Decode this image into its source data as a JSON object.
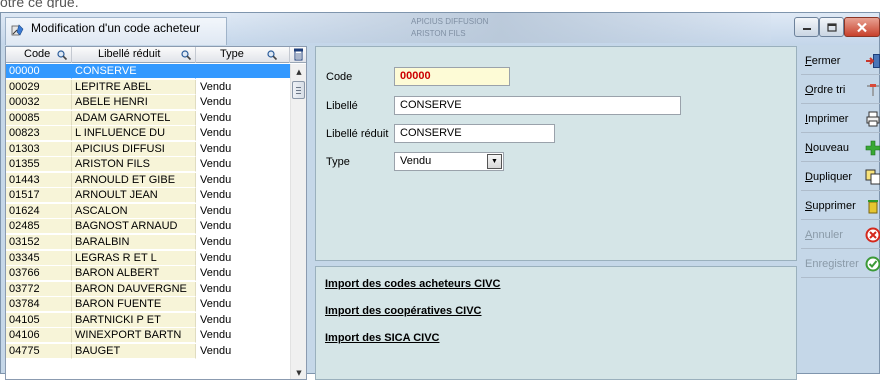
{
  "top_cut_text": "otre ce grue.",
  "window": {
    "title": "Modification d'un code acheteur",
    "background_blur_text": [
      "APICIUS DIFFUSION",
      "ARISTON FILS"
    ]
  },
  "grid": {
    "headers": [
      "Code",
      "Libellé réduit",
      "Type"
    ],
    "selected_index": 0,
    "rows": [
      {
        "code": "00000",
        "libelle": "CONSERVE",
        "type": ""
      },
      {
        "code": "00029",
        "libelle": "LEPITRE ABEL",
        "type": "Vendu"
      },
      {
        "code": "00032",
        "libelle": "ABELE HENRI",
        "type": "Vendu"
      },
      {
        "code": "00085",
        "libelle": "ADAM GARNOTEL",
        "type": "Vendu"
      },
      {
        "code": "00823",
        "libelle": "L INFLUENCE DU",
        "type": "Vendu"
      },
      {
        "code": "01303",
        "libelle": "APICIUS DIFFUSI",
        "type": "Vendu"
      },
      {
        "code": "01355",
        "libelle": "ARISTON FILS",
        "type": "Vendu"
      },
      {
        "code": "01443",
        "libelle": "ARNOULD ET GIBE",
        "type": "Vendu"
      },
      {
        "code": "01517",
        "libelle": "ARNOULT JEAN",
        "type": "Vendu"
      },
      {
        "code": "01624",
        "libelle": "ASCALON",
        "type": "Vendu"
      },
      {
        "code": "02485",
        "libelle": "BAGNOST ARNAUD",
        "type": "Vendu"
      },
      {
        "code": "03152",
        "libelle": "BARALBIN",
        "type": "Vendu"
      },
      {
        "code": "03345",
        "libelle": "LEGRAS R ET L",
        "type": "Vendu"
      },
      {
        "code": "03766",
        "libelle": "BARON ALBERT",
        "type": "Vendu"
      },
      {
        "code": "03772",
        "libelle": "BARON DAUVERGNE",
        "type": "Vendu"
      },
      {
        "code": "03784",
        "libelle": "BARON FUENTE",
        "type": "Vendu"
      },
      {
        "code": "04105",
        "libelle": "BARTNICKI P ET",
        "type": "Vendu"
      },
      {
        "code": "04106",
        "libelle": "WINEXPORT BARTN",
        "type": "Vendu"
      },
      {
        "code": "04775",
        "libelle": "BAUGET",
        "type": "Vendu"
      }
    ]
  },
  "form": {
    "code_label": "Code",
    "code_value": "00000",
    "libelle_label": "Libellé",
    "libelle_value": "CONSERVE",
    "libelle_reduit_label": "Libellé réduit",
    "libelle_reduit_value": "CONSERVE",
    "type_label": "Type",
    "type_value": "Vendu"
  },
  "imports": {
    "acheteurs": "Import des codes acheteurs CIVC",
    "cooperatives": "Import des coopératives CIVC",
    "sica": "Import des SICA CIVC"
  },
  "buttons": {
    "fermer": {
      "access": "F",
      "rest": "ermer"
    },
    "ordre_tri": {
      "access": "O",
      "rest": "rdre tri"
    },
    "imprimer": {
      "access": "I",
      "rest": "mprimer"
    },
    "nouveau": {
      "access": "N",
      "rest": "ouveau"
    },
    "dupliquer": {
      "access": "D",
      "rest": "upliquer"
    },
    "supprimer": {
      "access": "S",
      "rest": "upprimer"
    },
    "annuler": {
      "access": "A",
      "rest": "nnuler"
    },
    "enregistrer": {
      "access": "",
      "rest": "Enregistrer"
    }
  },
  "colors": {
    "selection": "#3399ff",
    "cell_yellow": "#f7f4d8",
    "panel": "#d5e5e7",
    "code_value": "#cc0000"
  }
}
